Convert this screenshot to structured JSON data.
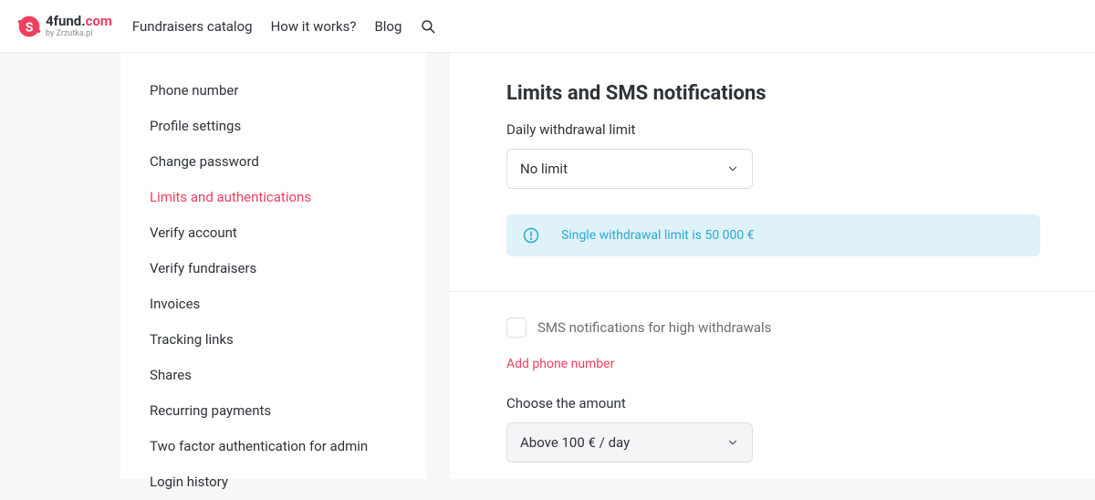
{
  "header": {
    "logo": {
      "brand_left": "4fund",
      "brand_dot": ".",
      "brand_right": "com",
      "sub": "by Zrzutka.pl"
    },
    "nav": [
      "Fundraisers catalog",
      "How it works?",
      "Blog"
    ]
  },
  "sidebar": {
    "items": [
      {
        "label": "Phone number",
        "active": false
      },
      {
        "label": "Profile settings",
        "active": false
      },
      {
        "label": "Change password",
        "active": false
      },
      {
        "label": "Limits and authentications",
        "active": true
      },
      {
        "label": "Verify account",
        "active": false
      },
      {
        "label": "Verify fundraisers",
        "active": false
      },
      {
        "label": "Invoices",
        "active": false
      },
      {
        "label": "Tracking links",
        "active": false
      },
      {
        "label": "Shares",
        "active": false
      },
      {
        "label": "Recurring payments",
        "active": false
      },
      {
        "label": "Two factor authentication for admin",
        "active": false
      },
      {
        "label": "Login history",
        "active": false
      }
    ]
  },
  "main": {
    "title": "Limits and SMS notifications",
    "daily_limit_label": "Daily withdrawal limit",
    "daily_limit_value": "No limit",
    "info_text": "Single withdrawal limit is 50 000 €",
    "sms_checkbox_label": "SMS notifications for high withdrawals",
    "add_phone_link": "Add phone number",
    "choose_amount_label": "Choose the amount",
    "choose_amount_value": "Above 100 € / day"
  }
}
